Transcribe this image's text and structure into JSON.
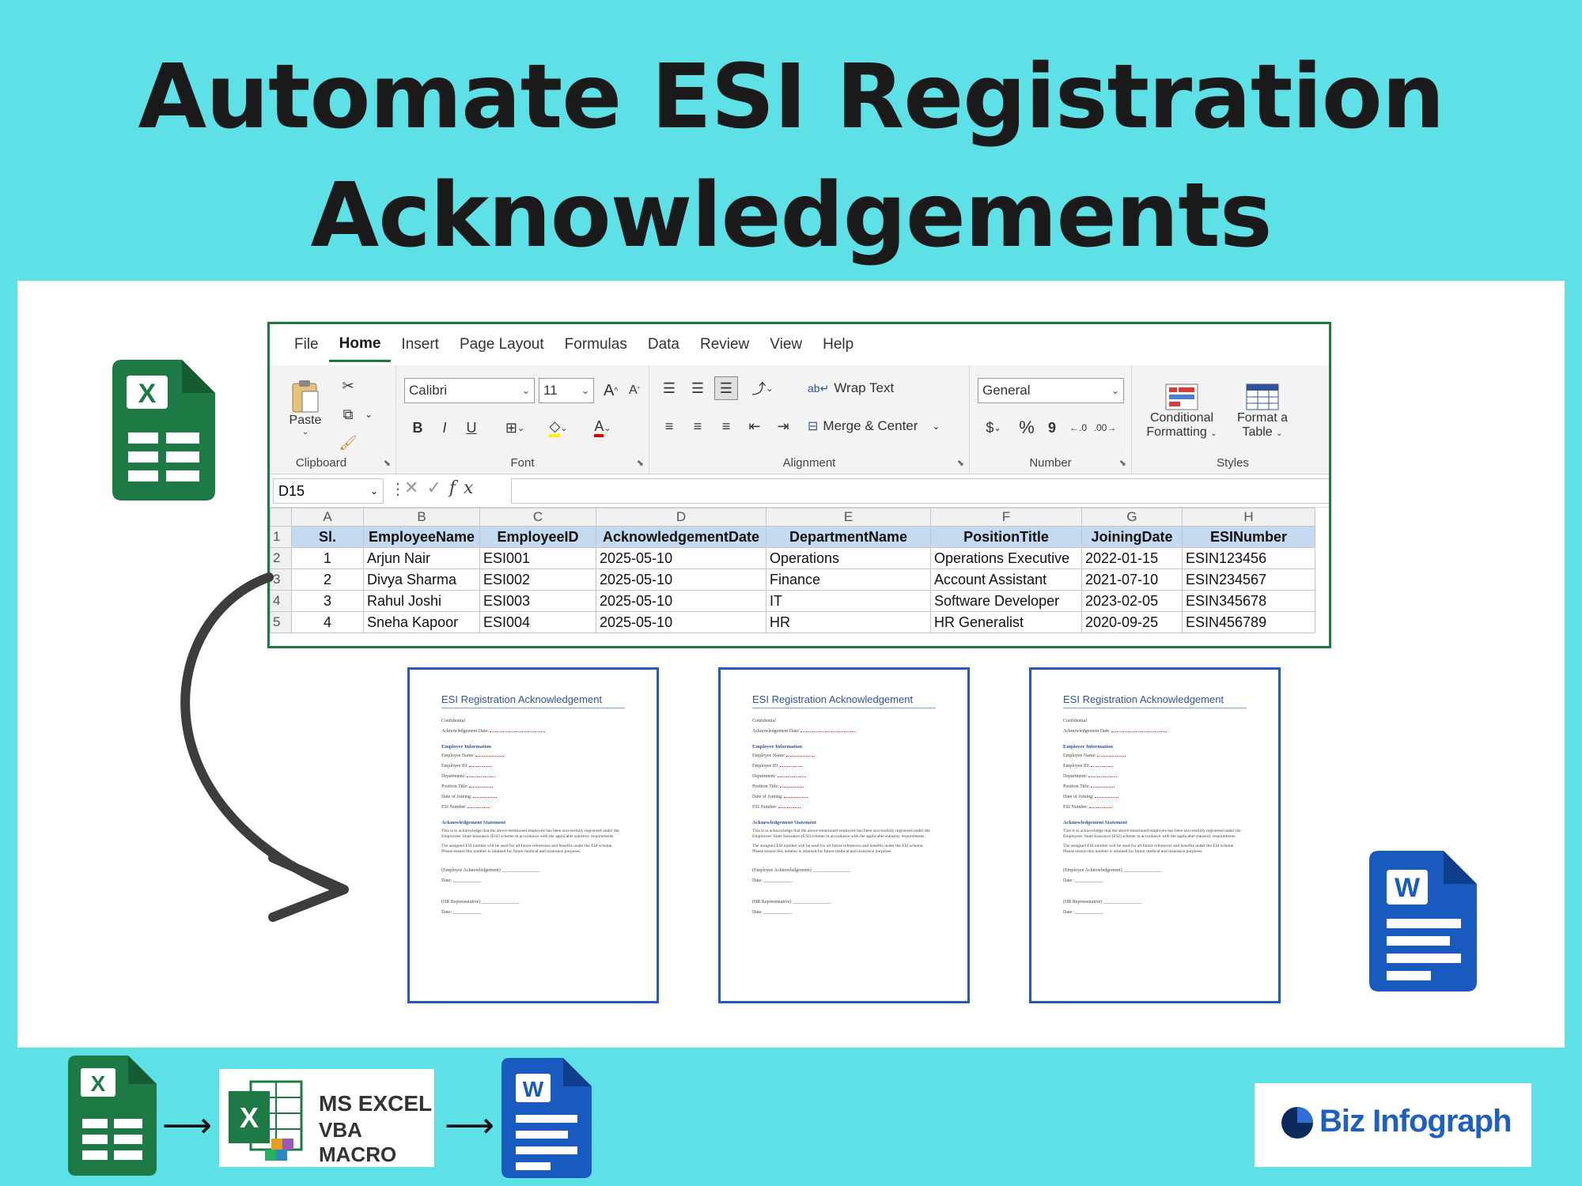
{
  "headline": {
    "line1": "Automate ESI Registration",
    "line2": "Acknowledgements"
  },
  "excel": {
    "menu": [
      "File",
      "Home",
      "Insert",
      "Page Layout",
      "Formulas",
      "Data",
      "Review",
      "View",
      "Help"
    ],
    "active_tab": "Home",
    "ribbon": {
      "clipboard": {
        "label": "Clipboard",
        "paste": "Paste"
      },
      "font": {
        "label": "Font",
        "name": "Calibri",
        "size": "11",
        "bold": "B",
        "italic": "I",
        "underline": "U"
      },
      "alignment": {
        "label": "Alignment",
        "wrap_text": "Wrap Text",
        "merge_center": "Merge & Center"
      },
      "number": {
        "label": "Number",
        "format": "General",
        "currency": "$",
        "percent": "%",
        "comma": "9"
      },
      "styles": {
        "label": "Styles",
        "conditional": "Conditional",
        "conditional2": "Formatting",
        "format_as": "Format a",
        "format_as2": "Table"
      }
    },
    "name_box": "D15",
    "fx": "fx",
    "columns": [
      "A",
      "B",
      "C",
      "D",
      "E",
      "F",
      "G",
      "H"
    ],
    "headers": [
      "Sl.",
      "EmployeeName",
      "EmployeeID",
      "AcknowledgementDate",
      "DepartmentName",
      "PositionTitle",
      "JoiningDate",
      "ESINumber"
    ],
    "rows": [
      [
        "1",
        "Arjun Nair",
        "ESI001",
        "2025-05-10",
        "Operations",
        "Operations Executive",
        "2022-01-15",
        "ESIN123456"
      ],
      [
        "2",
        "Divya Sharma",
        "ESI002",
        "2025-05-10",
        "Finance",
        "Account Assistant",
        "2021-07-10",
        "ESIN234567"
      ],
      [
        "3",
        "Rahul Joshi",
        "ESI003",
        "2025-05-10",
        "IT",
        "Software Developer",
        "2023-02-05",
        "ESIN345678"
      ],
      [
        "4",
        "Sneha Kapoor",
        "ESI004",
        "2025-05-10",
        "HR",
        "HR Generalist",
        "2020-09-25",
        "ESIN456789"
      ]
    ],
    "row_numbers": [
      "1",
      "2",
      "3",
      "4",
      "5"
    ]
  },
  "doc": {
    "title": "ESI Registration Acknowledgement",
    "confidential": "Confidential",
    "ack_date": "Acknowledgement Date:",
    "section1": "Employee Information",
    "fields": [
      "Employee Name:",
      "Employee ID:",
      "Department:",
      "Position Title:",
      "Date of Joining:",
      "ESI Number:"
    ],
    "section2": "Acknowledgement Statement",
    "para1": "This is to acknowledge that the above-mentioned employee has been successfully registered under the Employees' State Insurance (ESI) scheme in accordance with the applicable statutory requirements.",
    "para2": "The assigned ESI number will be used for all future references and benefits under the ESI scheme. Please ensure this number is retained for future medical and insurance purposes.",
    "sign1": "(Employee Acknowledgement) ________________",
    "date_line": "Date: ____________",
    "sign2": "(HR Representative) ________________"
  },
  "footer": {
    "vba_line1": "MS EXCEL",
    "vba_line2": "VBA MACRO",
    "brand": "Biz Infograph"
  },
  "icons": {
    "excel_letter": "X",
    "word_letter": "W"
  },
  "colors": {
    "background": "#5ee1e6",
    "excel_green": "#1d7a3a",
    "word_blue": "#185abd",
    "doc_border": "#2659b8",
    "header_fill": "#c5d9f1"
  }
}
